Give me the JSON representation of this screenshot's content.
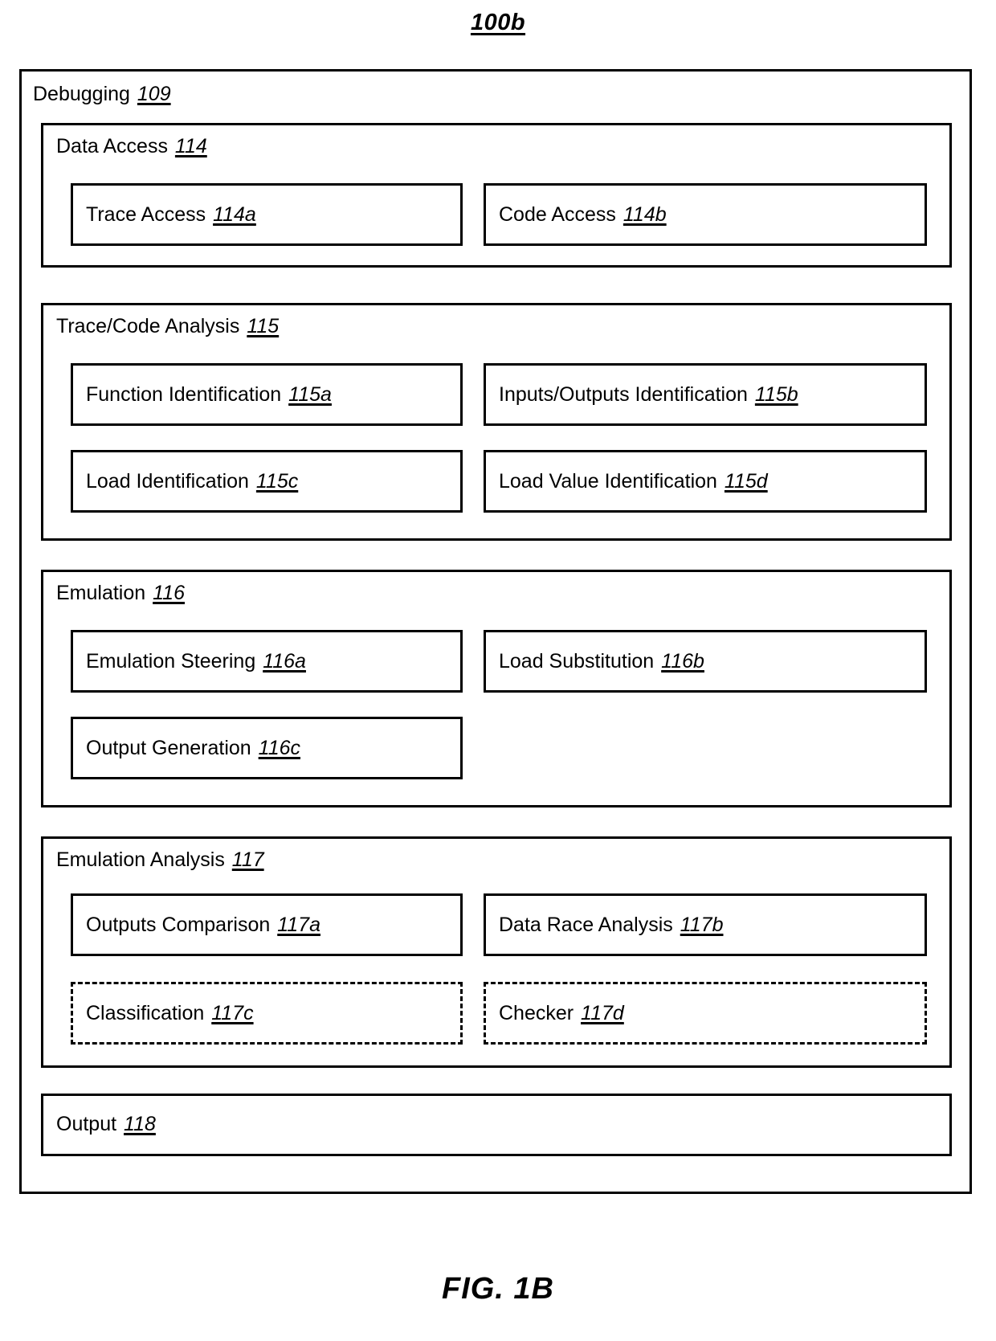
{
  "figure": {
    "top_label": "100b",
    "caption": "FIG. 1B"
  },
  "diagram": {
    "root": {
      "title": "Debugging",
      "ref": "109"
    },
    "groups": [
      {
        "title": "Data Access",
        "ref": "114",
        "items": [
          {
            "label": "Trace Access",
            "ref": "114a",
            "style": "solid",
            "column": "left",
            "row": 1
          },
          {
            "label": "Code Access",
            "ref": "114b",
            "style": "solid",
            "column": "right",
            "row": 1
          }
        ]
      },
      {
        "title": "Trace/Code Analysis",
        "ref": "115",
        "items": [
          {
            "label": "Function Identification",
            "ref": "115a",
            "style": "solid",
            "column": "left",
            "row": 1
          },
          {
            "label": "Inputs/Outputs Identification",
            "ref": "115b",
            "style": "solid",
            "column": "right",
            "row": 1
          },
          {
            "label": "Load Identification",
            "ref": "115c",
            "style": "solid",
            "column": "left",
            "row": 2
          },
          {
            "label": "Load Value Identification",
            "ref": "115d",
            "style": "solid",
            "column": "right",
            "row": 2
          }
        ]
      },
      {
        "title": "Emulation",
        "ref": "116",
        "items": [
          {
            "label": "Emulation Steering",
            "ref": "116a",
            "style": "solid",
            "column": "left",
            "row": 1
          },
          {
            "label": "Load Substitution",
            "ref": "116b",
            "style": "solid",
            "column": "right",
            "row": 1
          },
          {
            "label": "Output Generation",
            "ref": "116c",
            "style": "solid",
            "column": "left",
            "row": 2
          }
        ]
      },
      {
        "title": "Emulation Analysis",
        "ref": "117",
        "items": [
          {
            "label": "Outputs Comparison",
            "ref": "117a",
            "style": "solid",
            "column": "left",
            "row": 1
          },
          {
            "label": "Data Race Analysis",
            "ref": "117b",
            "style": "solid",
            "column": "right",
            "row": 1
          },
          {
            "label": "Classification",
            "ref": "117c",
            "style": "dashed",
            "column": "left",
            "row": 2
          },
          {
            "label": "Checker",
            "ref": "117d",
            "style": "dashed",
            "column": "right",
            "row": 2
          }
        ]
      },
      {
        "title": "Output",
        "ref": "118",
        "items": []
      }
    ]
  },
  "colors": {
    "stroke": "#000000",
    "background": "#ffffff"
  }
}
